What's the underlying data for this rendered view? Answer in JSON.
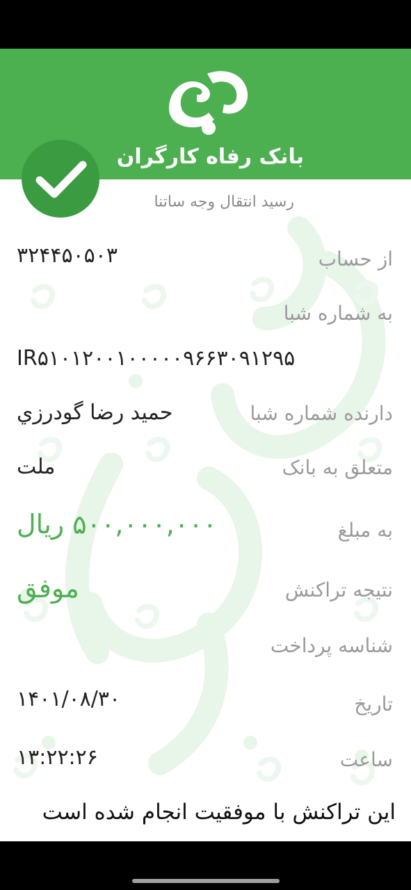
{
  "app": {
    "bank_name": "بانک رفاه کارگران",
    "receipt_title": "رسید انتقال وجه ساتنا",
    "logo_icon": "refah-bank-logo",
    "status_icon": "check-circle-icon"
  },
  "colors": {
    "brand_green": "#4caf50",
    "badge_green": "#3a9b40",
    "label_gray": "#9a9a9a"
  },
  "fields": {
    "from_account_label": "از حساب",
    "from_account_value": "۳۲۴۴۵۰۵۰۳",
    "to_sheba_label": "به شماره شبا",
    "to_sheba_value": "IR۵۱۰۱۲۰۰۱۰۰۰۰۰۹۶۶۳۰۹۱۲۹۵",
    "sheba_owner_label": "دارنده شماره شبا",
    "sheba_owner_value": "حمید رضا گودرزي",
    "bank_label": "متعلق  به بانک",
    "bank_value": "ملت",
    "amount_label": "به مبلغ",
    "amount_value": "۵۰۰,۰۰۰,۰۰۰  ریال",
    "result_label": "نتیجه  تراکنش",
    "result_value": "موفق",
    "payment_id_label": "شناسه پرداخت",
    "date_label": "تاریخ",
    "date_value": "۱۴۰۱/۰۸/۳۰",
    "time_label": "ساعت",
    "time_value": "۱۳:۲۲:۲۶"
  },
  "footer": {
    "message": "این  تراکنش با موفقیت انجام شده است"
  }
}
